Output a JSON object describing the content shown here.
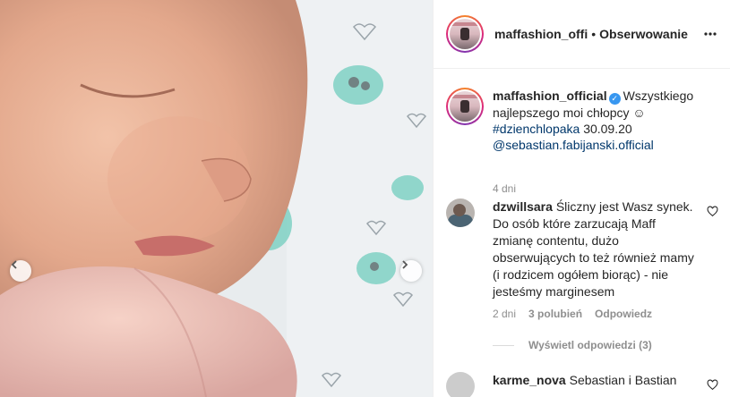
{
  "header": {
    "username": "maffashion_offi",
    "separator": "•",
    "follow_label": "Obserwowanie",
    "more_icon": "more-horizontal-icon"
  },
  "caption": {
    "username": "maffashion_official",
    "text": "Wszystkiego najlepszego moi chłopcy ☺",
    "hashtag": "#dzienchlopaka",
    "date": "30.09.20",
    "mention": "@sebastian.fabijanski.official",
    "time": "4 dni"
  },
  "comments": [
    {
      "username": "dzwillsara",
      "text": "Śliczny jest Wasz synek. Do osób które zarzucają Maff zmianę contentu, dużo obserwujących to też również mamy (i rodzicem ogółem biorąc) - nie jesteśmy marginesem",
      "time": "2 dni",
      "likes": "3 polubień",
      "reply_label": "Odpowiedz",
      "view_replies": "Wyświetl odpowiedzi (3)"
    },
    {
      "username": "karme_nova",
      "text": "Sebastian i Bastian"
    }
  ],
  "colors": {
    "link": "#00376b",
    "verified": "#3897f0",
    "muted": "#8e8e8e"
  }
}
